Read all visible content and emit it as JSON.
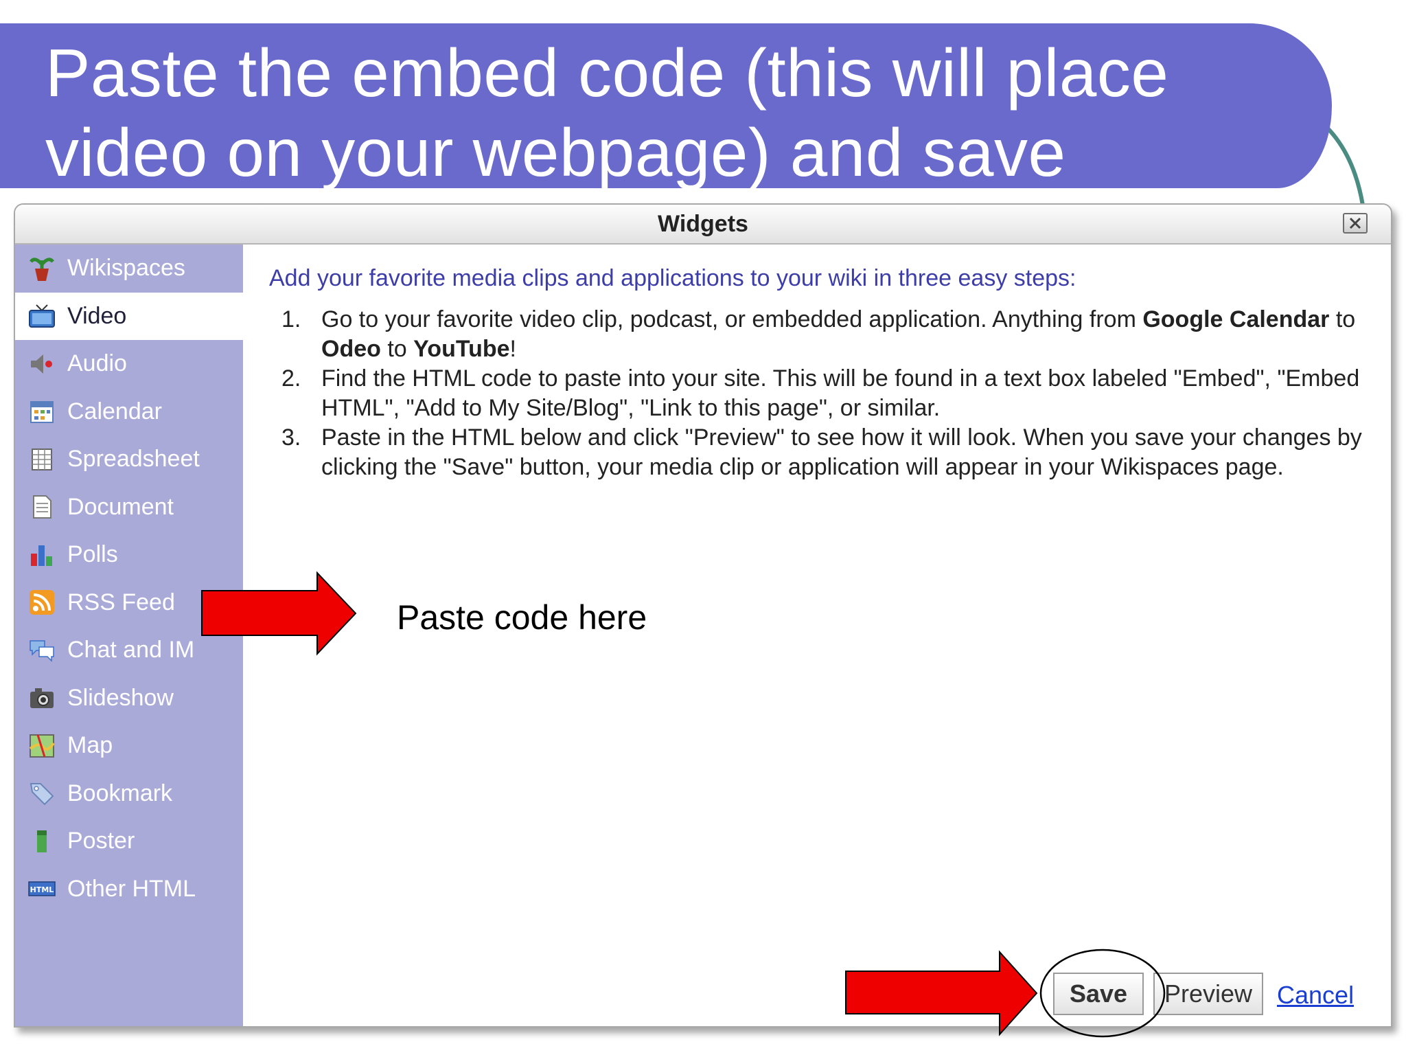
{
  "slide": {
    "title_line1": "Paste the embed code (this will place",
    "title_line2": "video on your webpage) and save"
  },
  "dialog": {
    "title": "Widgets"
  },
  "sidebar": {
    "items": [
      {
        "label": "Wikispaces",
        "icon": "wikispaces-plant-icon"
      },
      {
        "label": "Video",
        "icon": "tv-icon"
      },
      {
        "label": "Audio",
        "icon": "speaker-icon"
      },
      {
        "label": "Calendar",
        "icon": "calendar-icon"
      },
      {
        "label": "Spreadsheet",
        "icon": "spreadsheet-icon"
      },
      {
        "label": "Document",
        "icon": "document-icon"
      },
      {
        "label": "Polls",
        "icon": "bar-chart-icon"
      },
      {
        "label": "RSS Feed",
        "icon": "rss-icon"
      },
      {
        "label": "Chat and IM",
        "icon": "chat-bubbles-icon"
      },
      {
        "label": "Slideshow",
        "icon": "camera-icon"
      },
      {
        "label": "Map",
        "icon": "map-icon"
      },
      {
        "label": "Bookmark",
        "icon": "tag-icon"
      },
      {
        "label": "Poster",
        "icon": "poster-icon"
      },
      {
        "label": "Other HTML",
        "icon": "html-icon"
      }
    ],
    "selected": "Video"
  },
  "main": {
    "intro": "Add your favorite media clips and applications to your wiki in three easy steps:",
    "steps": [
      {
        "num": "1.",
        "t1": "Go to your favorite video clip, podcast, or embedded application. Anything from ",
        "b1": "Google Calendar",
        "t2": " to ",
        "b2": "Odeo",
        "t3": " to ",
        "b3": "YouTube",
        "t4": "!"
      },
      {
        "num": "2.",
        "text": "Find the HTML code to paste into your site. This will be found in a text box labeled \"Embed\", \"Embed HTML\", \"Add to My Site/Blog\", \"Link to this page\", or similar."
      },
      {
        "num": "3.",
        "text": "Paste in the HTML below and click \"Preview\" to see how it will look. When you save your changes by clicking the \"Save\" button, your media clip or application will appear in your Wikispaces page."
      }
    ],
    "embed_textarea_value": ""
  },
  "annotations": {
    "paste_label": "Paste code here"
  },
  "buttons": {
    "save": "Save",
    "preview": "Preview",
    "cancel": "Cancel"
  },
  "colors": {
    "title_banner": "#6a6acc",
    "sidebar_bg": "#aaaad8",
    "intro_text": "#3d3daa",
    "arrow": "#ee0000",
    "link": "#1a3fd0"
  }
}
